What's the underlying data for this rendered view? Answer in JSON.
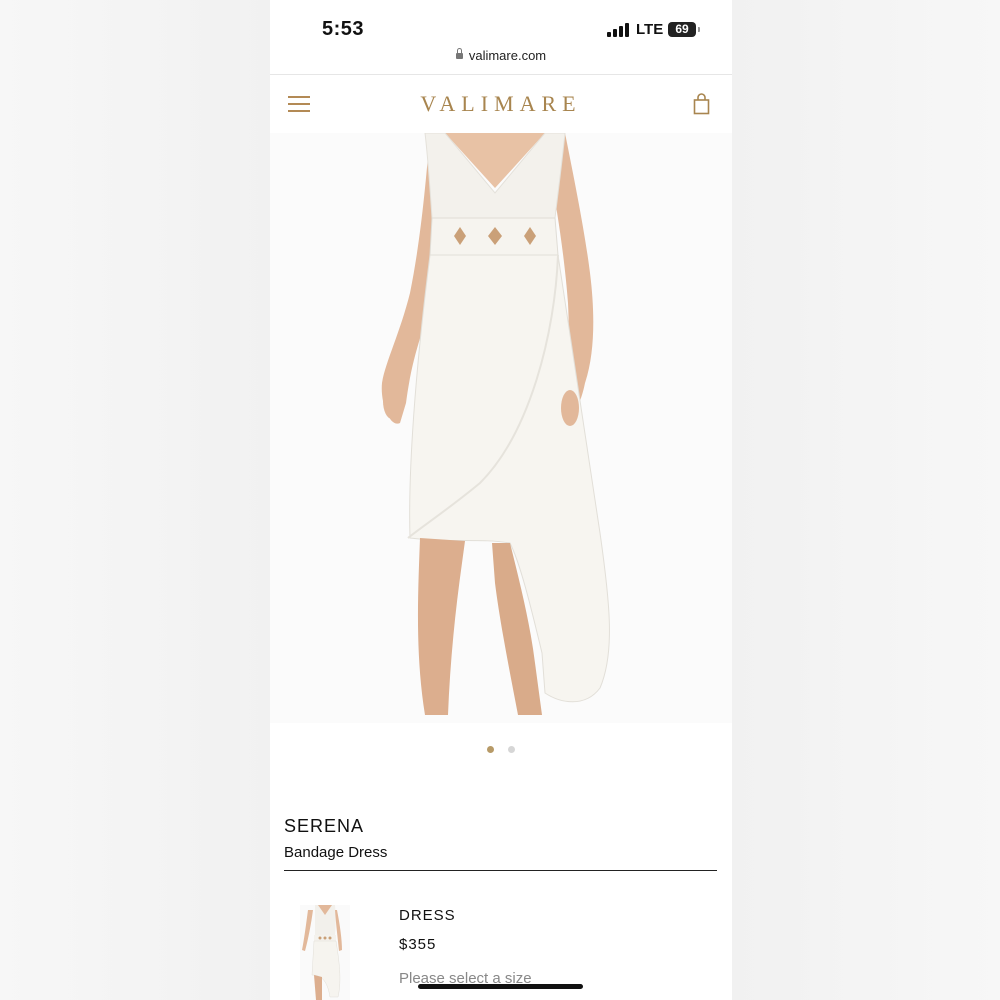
{
  "status": {
    "time": "5:53",
    "network": "LTE",
    "battery": "69"
  },
  "browser": {
    "url": "valimare.com"
  },
  "header": {
    "logo": "VALIMARE",
    "menu_icon": "hamburger-menu-icon",
    "cart_icon": "shopping-bag-icon"
  },
  "gallery": {
    "image_count": 2,
    "active_index": 0,
    "colors": {
      "active": "#b79a67",
      "inactive": "#d6d6d6"
    }
  },
  "product": {
    "name": "SERENA",
    "subtitle": "Bandage Dress"
  },
  "variant": {
    "title": "DRESS",
    "price": "$355",
    "size_placeholder": "Please select a size"
  },
  "colors": {
    "accent": "#a8854f",
    "text": "#111111"
  }
}
